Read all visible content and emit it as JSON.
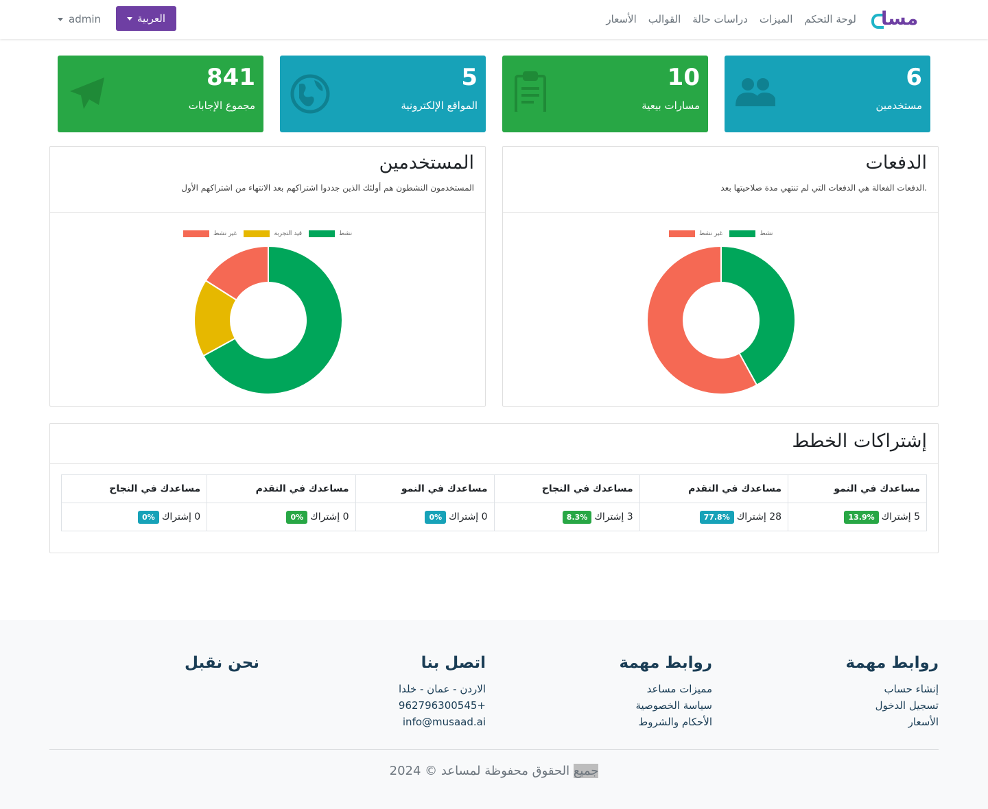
{
  "brand": {
    "logo_text": "مسا",
    "accent": "#6e3fa3",
    "accent2": "#1fb4c8"
  },
  "nav": {
    "links": [
      "لوحة التحكم",
      "الميزات",
      "دراسات حالة",
      "القوالب",
      "الأسعار"
    ],
    "language": "العربية",
    "user": "admin"
  },
  "stats": [
    {
      "value": "6",
      "label": "مستخدمين",
      "icon": "users-icon",
      "color": "#17a2b8"
    },
    {
      "value": "10",
      "label": "مسارات بيعية",
      "icon": "clipboard-icon",
      "color": "#28a745"
    },
    {
      "value": "5",
      "label": "المواقع الإلكترونية",
      "icon": "globe-icon",
      "color": "#17a2b8"
    },
    {
      "value": "841",
      "label": "مجموع الإجابات",
      "icon": "paper-plane-icon",
      "color": "#28a745"
    }
  ],
  "payments_panel": {
    "title": "الدفعات",
    "subtitle": "الدفعات الفعالة هي الدفعات التي لم تنتهي مدة صلاحيتها بعد."
  },
  "users_panel": {
    "title": "المستخدمين",
    "subtitle": "المستخدمون النشطون هم أولئك الذين جددوا اشتراكهم بعد الانتهاء من اشتراكهم الأول"
  },
  "chart_data": [
    {
      "type": "pie",
      "legend_position": "top",
      "categories": [
        "نشط",
        "غير نشط"
      ],
      "values": [
        42,
        58
      ],
      "colors": [
        "#00a65a",
        "#f56954"
      ]
    },
    {
      "type": "pie",
      "legend_position": "top",
      "categories": [
        "نشط",
        "قيد التجربة",
        "غير نشط"
      ],
      "values": [
        67,
        17,
        16
      ],
      "colors": [
        "#00a65a",
        "#e6b800",
        "#f56954"
      ]
    }
  ],
  "subscriptions": {
    "title": "إشتراكات الخطط",
    "unit": "إشتراك",
    "columns": [
      {
        "plan": "مساعدك في النمو",
        "count": "5",
        "pct": "13.9%",
        "badge": "#28a745"
      },
      {
        "plan": "مساعدك في التقدم",
        "count": "28",
        "pct": "77.8%",
        "badge": "#17a2b8"
      },
      {
        "plan": "مساعدك في النجاح",
        "count": "3",
        "pct": "8.3%",
        "badge": "#28a745"
      },
      {
        "plan": "مساعدك في النمو",
        "count": "0",
        "pct": "0%",
        "badge": "#17a2b8"
      },
      {
        "plan": "مساعدك في التقدم",
        "count": "0",
        "pct": "0%",
        "badge": "#28a745"
      },
      {
        "plan": "مساعدك في النجاح",
        "count": "0",
        "pct": "0%",
        "badge": "#17a2b8"
      }
    ]
  },
  "footer": {
    "col1": {
      "title": "روابط مهمة",
      "links": [
        "إنشاء حساب",
        "تسجيل الدخول",
        "الأسعار"
      ]
    },
    "col2": {
      "title": "روابط مهمة",
      "links": [
        "مميزات مساعد",
        "سياسة الخصوصية",
        "الأحكام والشروط"
      ]
    },
    "col3": {
      "title": "اتصل بنا",
      "address": "الاردن - عمان - خلدا",
      "phone": "962796300545+",
      "email": "info@musaad.ai"
    },
    "col4": {
      "title": "نحن نقبل"
    },
    "copyright_highlight": "جميع",
    "copyright_rest": " الحقوق محفوظة لمساعد © 2024"
  }
}
